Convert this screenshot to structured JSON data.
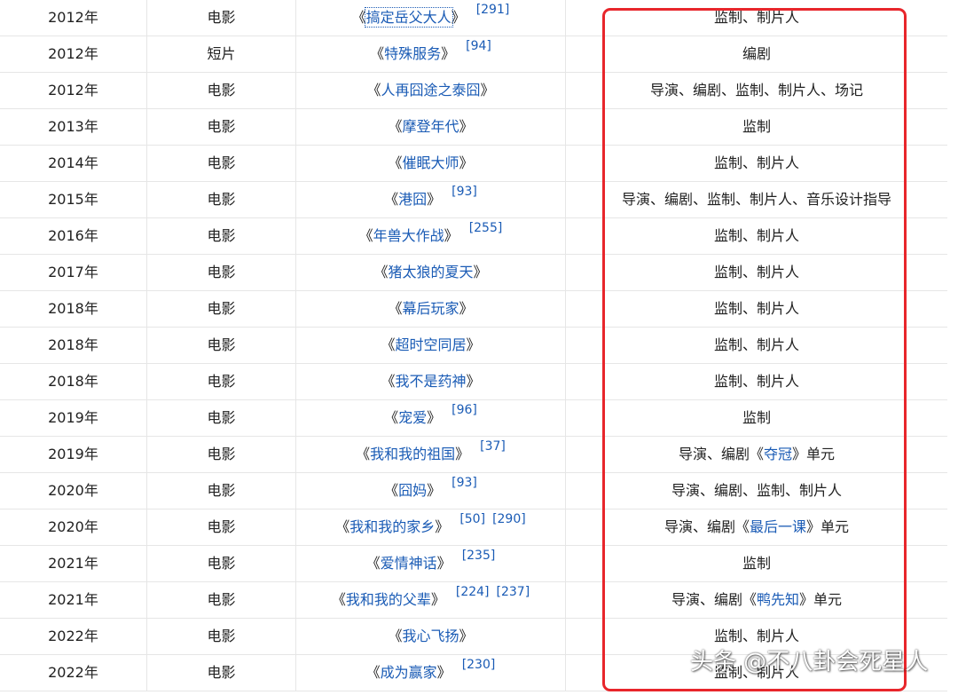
{
  "rows": [
    {
      "year": "2012年",
      "type": "电影",
      "work": "搞定岳父大人",
      "refs": [
        "[291]"
      ],
      "focused": true,
      "roles": [
        {
          "t": "监制、制片人"
        }
      ]
    },
    {
      "year": "2012年",
      "type": "短片",
      "work": "特殊服务",
      "refs": [
        "[94]"
      ],
      "roles": [
        {
          "t": "编剧"
        }
      ]
    },
    {
      "year": "2012年",
      "type": "电影",
      "work": "人再囧途之泰囧",
      "refs": [],
      "roles": [
        {
          "t": "导演、编剧、监制、制片人、场记"
        }
      ]
    },
    {
      "year": "2013年",
      "type": "电影",
      "work": "摩登年代",
      "refs": [],
      "roles": [
        {
          "t": "监制"
        }
      ]
    },
    {
      "year": "2014年",
      "type": "电影",
      "work": "催眠大师",
      "refs": [],
      "roles": [
        {
          "t": "监制、制片人"
        }
      ]
    },
    {
      "year": "2015年",
      "type": "电影",
      "work": "港囧",
      "refs": [
        "[93]"
      ],
      "roles": [
        {
          "t": "导演、编剧、监制、制片人、音乐设计指导"
        }
      ]
    },
    {
      "year": "2016年",
      "type": "电影",
      "work": "年兽大作战",
      "refs": [
        "[255]"
      ],
      "roles": [
        {
          "t": "监制、制片人"
        }
      ]
    },
    {
      "year": "2017年",
      "type": "电影",
      "work": "猪太狼的夏天",
      "refs": [],
      "roles": [
        {
          "t": "监制、制片人"
        }
      ]
    },
    {
      "year": "2018年",
      "type": "电影",
      "work": "幕后玩家",
      "refs": [],
      "roles": [
        {
          "t": "监制、制片人"
        }
      ]
    },
    {
      "year": "2018年",
      "type": "电影",
      "work": "超时空同居",
      "refs": [],
      "roles": [
        {
          "t": "监制、制片人"
        }
      ]
    },
    {
      "year": "2018年",
      "type": "电影",
      "work": "我不是药神",
      "refs": [],
      "roles": [
        {
          "t": "监制、制片人"
        }
      ]
    },
    {
      "year": "2019年",
      "type": "电影",
      "work": "宠爱",
      "refs": [
        "[96]"
      ],
      "roles": [
        {
          "t": "监制"
        }
      ]
    },
    {
      "year": "2019年",
      "type": "电影",
      "work": "我和我的祖国",
      "refs": [
        "[37]"
      ],
      "roles": [
        {
          "t": "导演、编剧《"
        },
        {
          "t": "夺冠",
          "link": true
        },
        {
          "t": "》单元"
        }
      ]
    },
    {
      "year": "2020年",
      "type": "电影",
      "work": "囧妈",
      "refs": [
        "[93]"
      ],
      "roles": [
        {
          "t": "导演、编剧、监制、制片人"
        }
      ]
    },
    {
      "year": "2020年",
      "type": "电影",
      "work": "我和我的家乡",
      "refs": [
        "[50]",
        "[290]"
      ],
      "roles": [
        {
          "t": "导演、编剧《"
        },
        {
          "t": "最后一课",
          "link": true
        },
        {
          "t": "》单元"
        }
      ]
    },
    {
      "year": "2021年",
      "type": "电影",
      "work": "爱情神话",
      "refs": [
        "[235]"
      ],
      "roles": [
        {
          "t": "监制"
        }
      ]
    },
    {
      "year": "2021年",
      "type": "电影",
      "work": "我和我的父辈",
      "refs": [
        "[224]",
        "[237]"
      ],
      "roles": [
        {
          "t": "导演、编剧《"
        },
        {
          "t": "鸭先知",
          "link": true
        },
        {
          "t": "》单元"
        }
      ]
    },
    {
      "year": "2022年",
      "type": "电影",
      "work": "我心飞扬",
      "refs": [],
      "roles": [
        {
          "t": "监制、制片人"
        }
      ]
    },
    {
      "year": "2022年",
      "type": "电影",
      "work": "成为赢家",
      "refs": [
        "[230]"
      ],
      "roles": [
        {
          "t": "监制、制片人"
        }
      ]
    }
  ],
  "watermark": "头条 @不八卦会死星人",
  "highlight_color": "#e8262b",
  "link_color": "#1a5bb5"
}
